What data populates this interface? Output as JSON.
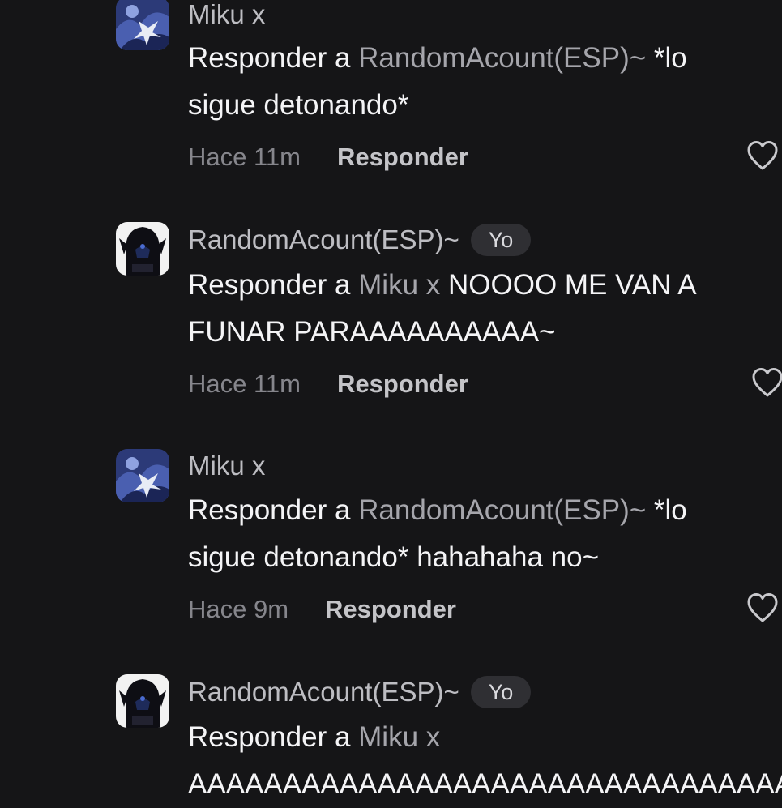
{
  "comments": [
    {
      "author": "Miku x",
      "is_self": false,
      "badge": "",
      "reply_prefix": "Responder a ",
      "reply_target": "RandomAcount(ESP)~",
      "text_line1": " *lo",
      "text_line2": "sigue detonando*",
      "time": "Hace 11m",
      "reply_label": "Responder",
      "avatar": "miku-avatar"
    },
    {
      "author": "RandomAcount(ESP)~",
      "is_self": true,
      "badge": "Yo",
      "reply_prefix": "Responder a ",
      "reply_target": "Miku x",
      "text_line1": " NOOOO ME VAN A",
      "text_line2": "FUNAR PARAAAAAAAAAA~",
      "time": "Hace 11m",
      "reply_label": "Responder",
      "avatar": "random-avatar"
    },
    {
      "author": "Miku x",
      "is_self": false,
      "badge": "",
      "reply_prefix": "Responder a ",
      "reply_target": "RandomAcount(ESP)~",
      "text_line1": " *lo",
      "text_line2": "sigue detonando* hahahaha no~",
      "time": "Hace 9m",
      "reply_label": "Responder",
      "avatar": "miku-avatar"
    },
    {
      "author": "RandomAcount(ESP)~",
      "is_self": true,
      "badge": "Yo",
      "reply_prefix": "Responder a ",
      "reply_target": "Miku x",
      "text_line1": "",
      "text_line2": "AAAAAAAAAAAAAAAAAAAAAAAAAAAAAAAAAA",
      "avatar": "random-avatar"
    }
  ],
  "icons": {
    "like": "heart-outline-icon"
  },
  "colors": {
    "background": "#151517",
    "author": "#bdbdc2",
    "reply_target": "#a5a5ab",
    "body_text": "#f4f4f6",
    "time": "#86868c",
    "badge_bg": "#2f2f33"
  }
}
